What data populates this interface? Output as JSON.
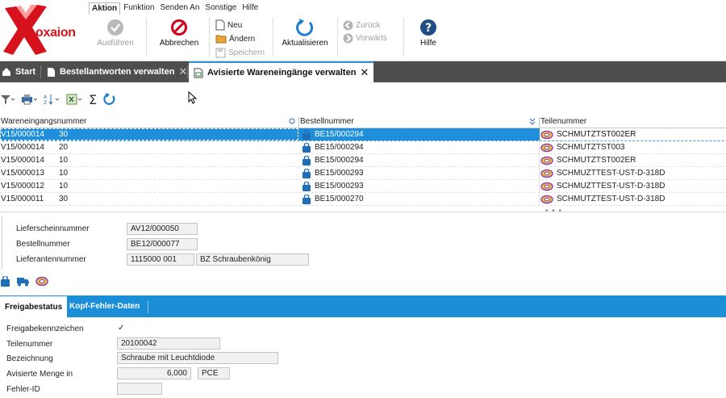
{
  "app": {
    "logo_text": "oxaion"
  },
  "menu": [
    "Aktion",
    "Funktion",
    "Senden An",
    "Sonstige",
    "Hilfe"
  ],
  "ribbon": {
    "ausfuehren": "Ausführen",
    "abbrechen": "Abbrechen",
    "neu": "Neu",
    "aendern": "Ändern",
    "speichern": "Speichern",
    "aktualisieren": "Aktualisieren",
    "zurueck": "Zurück",
    "vorwaerts": "Vorwärts",
    "hilfe": "Hilfe"
  },
  "tabs": {
    "start": "Start",
    "bestellantworten": "Bestellantworten verwalten",
    "wareneingaenge": "Avisierte Wareneingänge verwalten"
  },
  "table": {
    "headers": [
      "Wareneingangsnummer",
      "Bestellnummer",
      "Teilenummer"
    ],
    "rows": [
      {
        "we": "V15/000014",
        "pos": "30",
        "bestell": "BE15/000294",
        "teil": "SCHMUTZTST002ER",
        "selected": true
      },
      {
        "we": "V15/000014",
        "pos": "20",
        "bestell": "BE15/000294",
        "teil": "SCHMUTZTST003",
        "selected": false
      },
      {
        "we": "V15/000014",
        "pos": "10",
        "bestell": "BE15/000294",
        "teil": "SCHMUTZTST002ER",
        "selected": false
      },
      {
        "we": "V15/000013",
        "pos": "10",
        "bestell": "BE15/000293",
        "teil": "SCHMUZTTEST-UST-D-318D",
        "selected": false
      },
      {
        "we": "V15/000012",
        "pos": "10",
        "bestell": "BE15/000293",
        "teil": "SCHMUZTTEST-UST-D-318D",
        "selected": false
      },
      {
        "we": "V15/000011",
        "pos": "30",
        "bestell": "BE15/000270",
        "teil": "SCHMUTZTEST-UST-D-318D",
        "selected": false
      }
    ],
    "more": "• • •"
  },
  "header_detail": {
    "lieferschein_label": "Lieferscheinnummer",
    "lieferschein_value": "AV12/000050",
    "bestell_label": "Bestellnummer",
    "bestell_value": "BE12/000077",
    "lieferant_label": "Lieferantennummer",
    "lieferant_value": "1115000 001",
    "lieferant_name": "BZ Schraubenkönig"
  },
  "bottom_tabs": {
    "freigabe": "Freigabestatus",
    "kopf_fehler": "Kopf-Fehler-Daten"
  },
  "freigabe": {
    "kennzeichen_label": "Freigabekennzeichen",
    "kennzeichen_value": "✓",
    "teil_label": "Teilenummer",
    "teil_value": "20100042",
    "bez_label": "Bezeichnung",
    "bez_value": "Schraube mit Leuchtdiode",
    "menge_label": "Avisierte Menge in",
    "menge_value": "6,000",
    "menge_unit": "PCE",
    "fehler_label": "Fehler-ID",
    "fehler_value": ""
  },
  "colors": {
    "accent": "#1f8fdc",
    "brand": "#d6121d",
    "tabbar": "#4e4e4e"
  },
  "icons": [
    "oxaion-logo-icon",
    "check-icon",
    "cancel-icon",
    "document-new-icon",
    "folder-edit-icon",
    "save-icon",
    "refresh-icon",
    "back-icon",
    "forward-icon",
    "help-icon",
    "home-icon",
    "document-icon",
    "filter-icon",
    "print-icon",
    "sort-icon",
    "export-icon",
    "sum-icon",
    "bag-icon",
    "part-icon",
    "truck-icon"
  ]
}
